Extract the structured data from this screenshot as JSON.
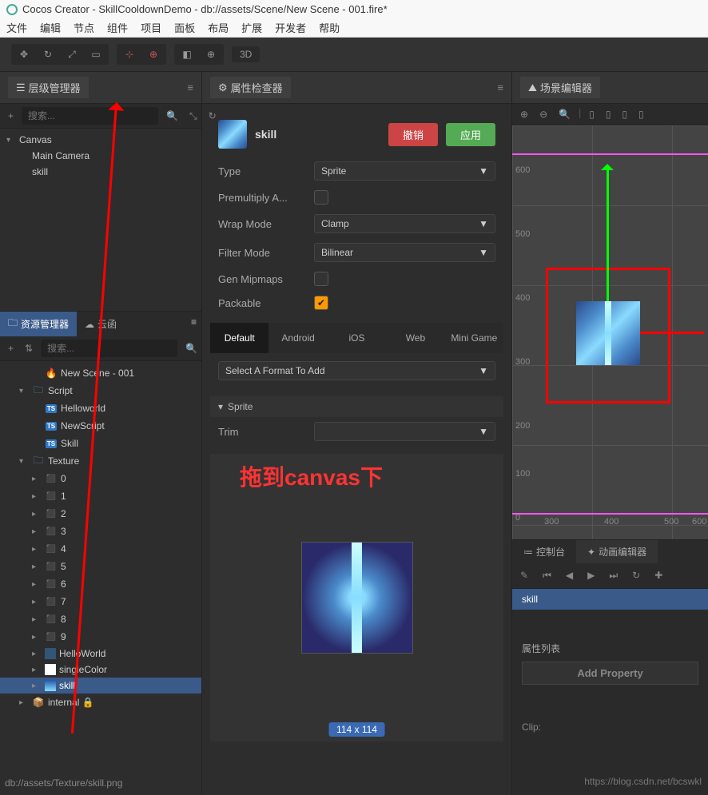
{
  "title": "Cocos Creator - SkillCooldownDemo - db://assets/Scene/New Scene - 001.fire*",
  "menu": [
    "文件",
    "编辑",
    "节点",
    "组件",
    "项目",
    "面板",
    "布局",
    "扩展",
    "开发者",
    "帮助"
  ],
  "toolbar": {
    "btn_3d": "3D"
  },
  "hierarchy": {
    "title": "层级管理器",
    "search_placeholder": "搜索...",
    "items": [
      {
        "label": "Canvas",
        "indent": 0,
        "arrow": "▾"
      },
      {
        "label": "Main Camera",
        "indent": 1
      },
      {
        "label": "skill",
        "indent": 1,
        "sel": false
      }
    ]
  },
  "assets": {
    "title": "资源管理器",
    "cloud": "云函",
    "search_placeholder": "搜索...",
    "items": [
      {
        "label": "New Scene - 001",
        "indent": 2,
        "icon": "fire"
      },
      {
        "label": "Script",
        "indent": 1,
        "icon": "folder",
        "arrow": "▾"
      },
      {
        "label": "Helloworld",
        "indent": 2,
        "icon": "ts"
      },
      {
        "label": "NewScript",
        "indent": 2,
        "icon": "ts"
      },
      {
        "label": "Skill",
        "indent": 2,
        "icon": "ts"
      },
      {
        "label": "Texture",
        "indent": 1,
        "icon": "folder",
        "arrow": "▾"
      },
      {
        "label": "0",
        "indent": 2,
        "icon": "tex",
        "arrow": "▸"
      },
      {
        "label": "1",
        "indent": 2,
        "icon": "tex",
        "arrow": "▸"
      },
      {
        "label": "2",
        "indent": 2,
        "icon": "tex",
        "arrow": "▸"
      },
      {
        "label": "3",
        "indent": 2,
        "icon": "tex",
        "arrow": "▸"
      },
      {
        "label": "4",
        "indent": 2,
        "icon": "tex",
        "arrow": "▸"
      },
      {
        "label": "5",
        "indent": 2,
        "icon": "tex",
        "arrow": "▸"
      },
      {
        "label": "6",
        "indent": 2,
        "icon": "tex",
        "arrow": "▸"
      },
      {
        "label": "7",
        "indent": 2,
        "icon": "tex",
        "arrow": "▸"
      },
      {
        "label": "8",
        "indent": 2,
        "icon": "tex",
        "arrow": "▸"
      },
      {
        "label": "9",
        "indent": 2,
        "icon": "tex",
        "arrow": "▸"
      },
      {
        "label": "HelloWorld",
        "indent": 2,
        "icon": "img",
        "arrow": "▸"
      },
      {
        "label": "singleColor",
        "indent": 2,
        "icon": "white",
        "arrow": "▸"
      },
      {
        "label": "skill",
        "indent": 2,
        "icon": "skill",
        "arrow": "▸",
        "sel": true
      },
      {
        "label": "internal 🔒",
        "indent": 1,
        "icon": "pkg",
        "arrow": "▸"
      }
    ]
  },
  "inspector": {
    "title": "属性检查器",
    "asset_name": "skill",
    "btn_revert": "撤销",
    "btn_apply": "应用",
    "props": {
      "type_label": "Type",
      "type_value": "Sprite",
      "premul_label": "Premultiply A...",
      "premul_value": false,
      "wrap_label": "Wrap Mode",
      "wrap_value": "Clamp",
      "filter_label": "Filter Mode",
      "filter_value": "Bilinear",
      "mipmap_label": "Gen Mipmaps",
      "mipmap_value": false,
      "packable_label": "Packable",
      "packable_value": true
    },
    "platforms": [
      "Default",
      "Android",
      "iOS",
      "Web",
      "Mini Game"
    ],
    "format_select": "Select A Format To Add",
    "sprite_section": "Sprite",
    "trim_label": "Trim",
    "preview_badge": "114 x 114"
  },
  "scene": {
    "title": "场景编辑器",
    "axis_y": [
      "600",
      "500",
      "400",
      "300",
      "200",
      "100",
      "0"
    ],
    "axis_x": [
      "300",
      "400",
      "500",
      "600"
    ]
  },
  "bottom": {
    "console": "控制台",
    "animator": "动画编辑器",
    "clip_name": "skill",
    "props_title": "属性列表",
    "add_prop": "Add Property",
    "clip_label": "Clip:"
  },
  "annotation": "拖到canvas下",
  "status": "db://assets/Texture/skill.png",
  "watermark": "https://blog.csdn.net/bcswkl"
}
